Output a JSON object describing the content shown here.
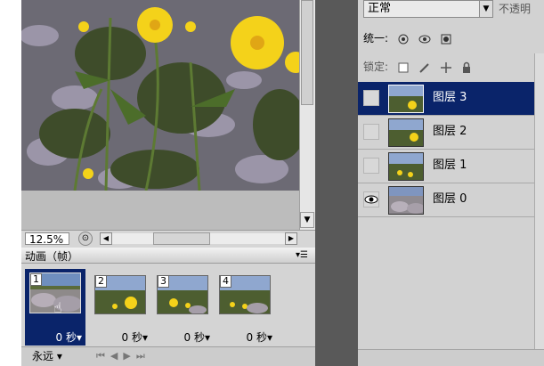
{
  "document": {
    "zoom": "12.5%"
  },
  "animation": {
    "tab_label": "动画（帧）",
    "loop_label": "永远",
    "frames": [
      {
        "number": "1",
        "time": "0 秒",
        "selected": true
      },
      {
        "number": "2",
        "time": "0 秒",
        "selected": false
      },
      {
        "number": "3",
        "time": "0 秒",
        "selected": false
      },
      {
        "number": "4",
        "time": "0 秒",
        "selected": false
      }
    ]
  },
  "layers_panel": {
    "blend_mode": "正常",
    "opacity_label": "不透明",
    "unify_label": "统一:",
    "lock_label": "锁定:",
    "layers": [
      {
        "name": "图层 3",
        "selected": true,
        "visible": false
      },
      {
        "name": "图层 2",
        "selected": false,
        "visible": false
      },
      {
        "name": "图层 1",
        "selected": false,
        "visible": false
      },
      {
        "name": "图层 0",
        "selected": false,
        "visible": true
      }
    ]
  },
  "colors": {
    "selection": "#0a246a",
    "panel_bg": "#d2d2d2",
    "separator": "#595959",
    "flower_yellow": "#f4d21a"
  }
}
